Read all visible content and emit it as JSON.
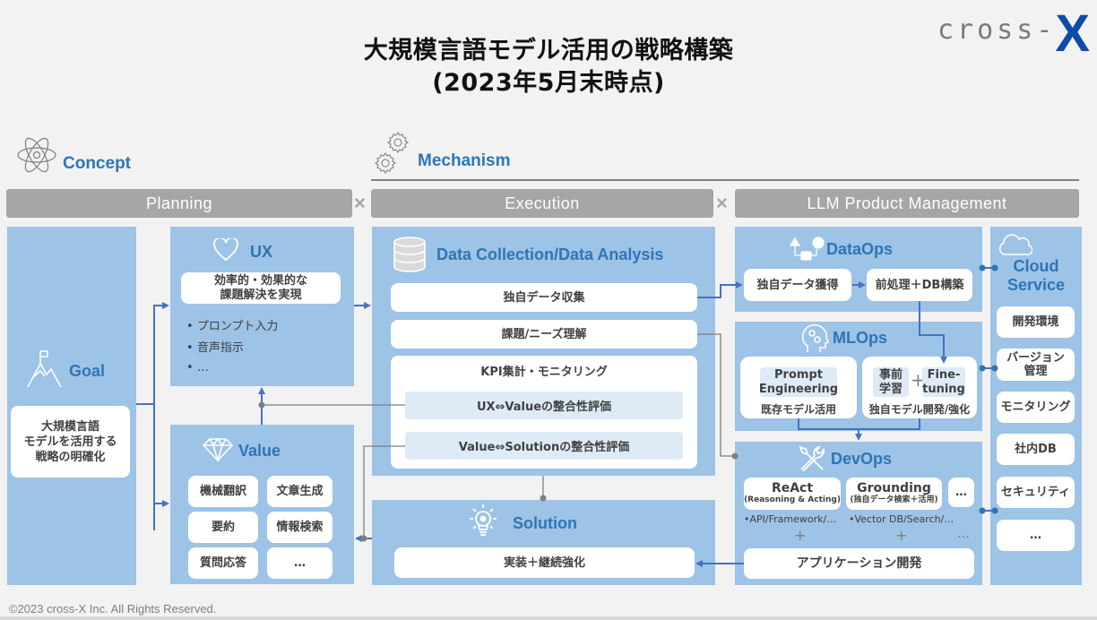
{
  "header": {
    "title_line1": "大規模言語モデル活用の戦略構築",
    "title_line2": "(2023年5月末時点)",
    "logo_text": "cross-",
    "logo_mark": "X"
  },
  "sections": {
    "concept": "Concept",
    "mechanism": "Mechanism"
  },
  "phases": [
    {
      "label": "Planning"
    },
    {
      "label": "Execution"
    },
    {
      "label": "LLM Product Management"
    }
  ],
  "phase_separator": "×",
  "goal": {
    "title": "Goal",
    "text": "大規模言語\nモデルを活用する\n戦略の明確化",
    "lines": [
      "大規模言語",
      "モデルを活用する",
      "戦略の明確化"
    ]
  },
  "ux": {
    "title": "UX",
    "highlight_lines": [
      "効率的・効果的な",
      "課題解決を実現"
    ],
    "bullets": [
      "プロンプト入力",
      "音声指示",
      "…"
    ]
  },
  "value": {
    "title": "Value",
    "items": [
      "機械翻訳",
      "文章生成",
      "要約",
      "情報検索",
      "質問応答",
      "…"
    ]
  },
  "data_collection": {
    "title": "Data Collection/Data Analysis",
    "items": [
      "独自データ収集",
      "課題/ニーズ理解"
    ],
    "kpi": {
      "title": "KPI集計・モニタリング",
      "items": [
        "UX⇔Valueの整合性評価",
        "Value⇔Solutionの整合性評価"
      ]
    }
  },
  "solution": {
    "title": "Solution",
    "item": "実装＋継続強化"
  },
  "dataops": {
    "title": "DataOps",
    "items": [
      "独自データ獲得",
      "前処理＋DB構築"
    ]
  },
  "mlops": {
    "title": "MLOps",
    "left": {
      "label_lines": [
        "Prompt",
        "Engineering"
      ],
      "caption": "既存モデル活用"
    },
    "right": {
      "pre": [
        "事前",
        "学習"
      ],
      "plus": "+",
      "fine": [
        "Fine-",
        "tuning"
      ],
      "caption": "独自モデル開発/強化"
    }
  },
  "devops": {
    "title": "DevOps",
    "boxes": [
      {
        "title": "ReAct",
        "sub": "(Reasoning & Acting)"
      },
      {
        "title": "Grounding",
        "sub": "(独自データ検索＋活用)"
      },
      {
        "title": "…",
        "sub": ""
      }
    ],
    "notes": [
      "•API/Framework/…",
      "•Vector DB/Search/…"
    ],
    "plus": "+",
    "more": "…",
    "app": "アプリケーション開発"
  },
  "cloud": {
    "title_lines": [
      "Cloud",
      "Service"
    ],
    "items": [
      "開発環境",
      "バージョン\n管理",
      "モニタリング",
      "社内DB",
      "セキュリティ",
      "…"
    ],
    "item_lines": [
      [
        "開発環境"
      ],
      [
        "バージョン",
        "管理"
      ],
      [
        "モニタリング"
      ],
      [
        "社内DB"
      ],
      [
        "セキュリティ"
      ],
      [
        "…"
      ]
    ]
  },
  "footer": "©2023 cross-X Inc. All Rights Reserved.",
  "colors": {
    "panel": "#9dc3e6",
    "accent_blue": "#2e75b6",
    "arrow_blue": "#4472c4",
    "phase_gray": "#a6a6a6",
    "connector_gray": "#7f7f7f",
    "logo_blue": "#0e4aa8"
  }
}
